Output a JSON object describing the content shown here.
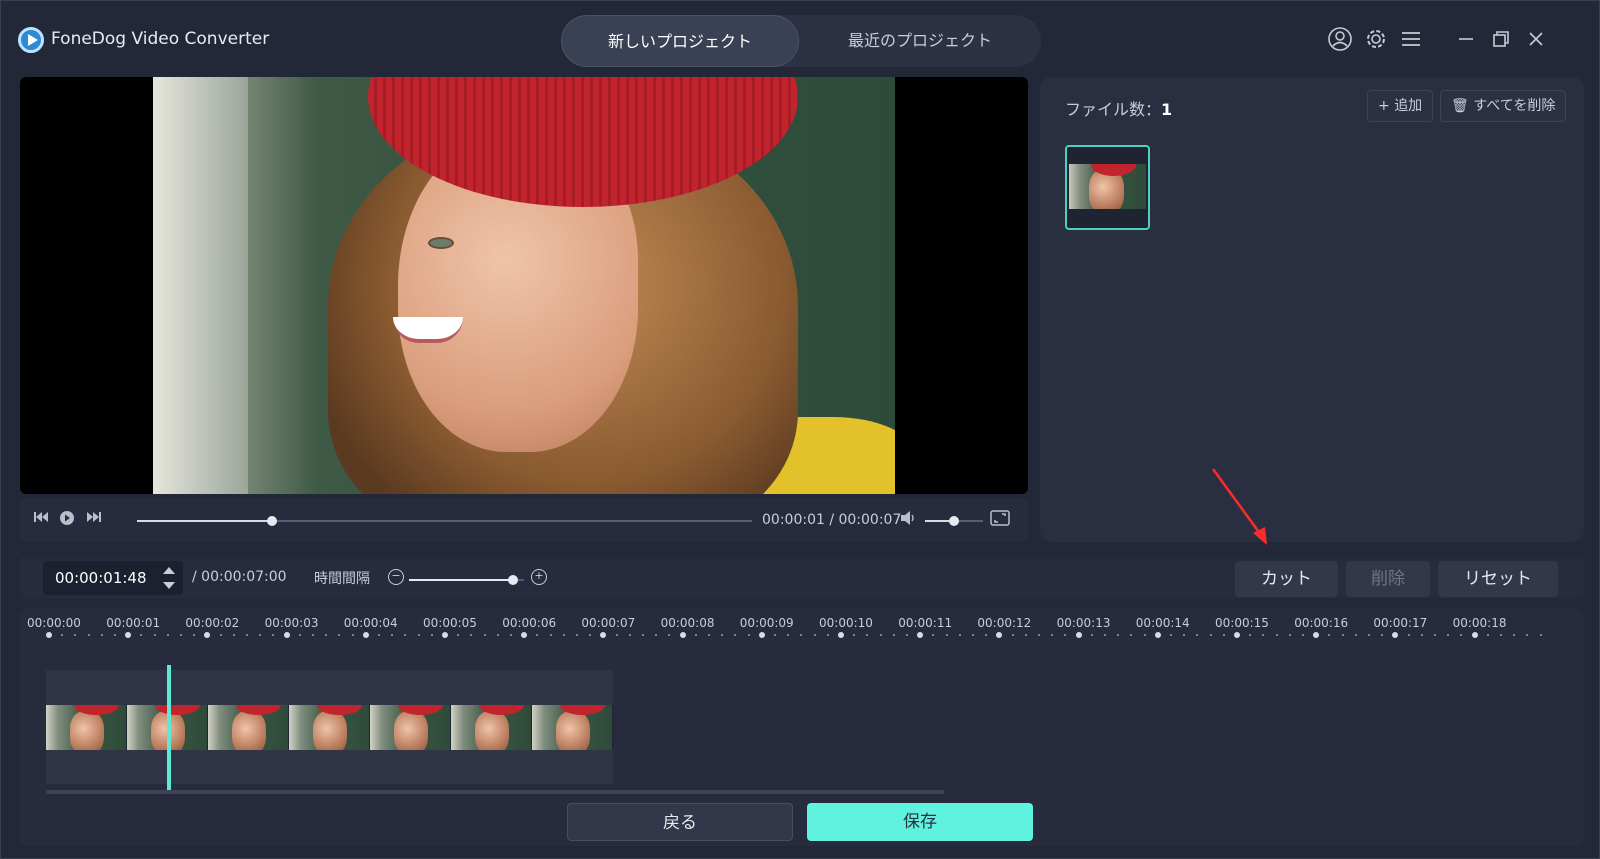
{
  "app": {
    "title": "FoneDog Video Converter"
  },
  "tabs": [
    {
      "label": "新しいプロジェクト",
      "active": true
    },
    {
      "label": "最近のプロジェクト",
      "active": false
    }
  ],
  "window_icons": [
    "user-icon",
    "gear-icon",
    "menu-icon",
    "minimize-icon",
    "restore-icon",
    "close-icon"
  ],
  "player": {
    "current_time": "00:00:01",
    "duration": "00:00:07",
    "time_readout": "00:00:01 / 00:00:07",
    "progress": 0.22,
    "volume": 0.5
  },
  "files": {
    "count_label": "ファイル数：",
    "count": "1",
    "add_label": "追加",
    "delete_all_label": "すべてを削除"
  },
  "edit": {
    "time_value": "00:00:01:48",
    "total_time": "/ 00:00:07:00",
    "interval_label": "時間間隔",
    "zoom": 0.9,
    "cut_label": "カット",
    "delete_label": "削除",
    "reset_label": "リセット"
  },
  "timeline": {
    "ticks": [
      "00:00:00",
      "00:00:01",
      "00:00:02",
      "00:00:03",
      "00:00:04",
      "00:00:05",
      "00:00:06",
      "00:00:07",
      "00:00:08",
      "00:00:09",
      "00:00:10",
      "00:00:11",
      "00:00:12",
      "00:00:13",
      "00:00:14",
      "00:00:15",
      "00:00:16",
      "00:00:17",
      "00:00:18"
    ],
    "frame_count": 7
  },
  "footer": {
    "back_label": "戻る",
    "save_label": "保存"
  },
  "colors": {
    "accent": "#5ff2de",
    "background": "#232838",
    "annotation_arrow": "#ff2a2a"
  }
}
